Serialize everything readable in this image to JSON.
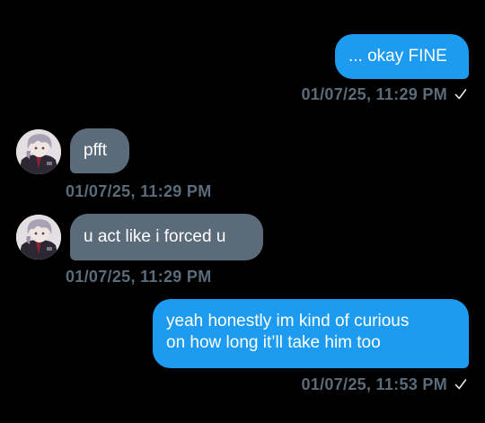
{
  "messages": [
    {
      "direction": "sent",
      "text": "... okay FINE",
      "timestamp": "01/07/25, 11:29 PM",
      "status": "checkmark-icon"
    },
    {
      "direction": "received",
      "text": "pfft",
      "timestamp": "01/07/25, 11:29 PM"
    },
    {
      "direction": "received",
      "text": "u act like i forced u",
      "timestamp": "01/07/25, 11:29 PM"
    },
    {
      "direction": "sent",
      "lines": [
        "yeah honestly im kind of curious",
        "on how long it’ll take him too"
      ],
      "timestamp": "01/07/25, 11:53 PM",
      "status": "checkmark-icon"
    }
  ],
  "colors": {
    "background": "#000000",
    "sent_bubble": "#1d9bf0",
    "received_bubble": "#5b6b79",
    "timestamp_text": "#5b6b79"
  }
}
